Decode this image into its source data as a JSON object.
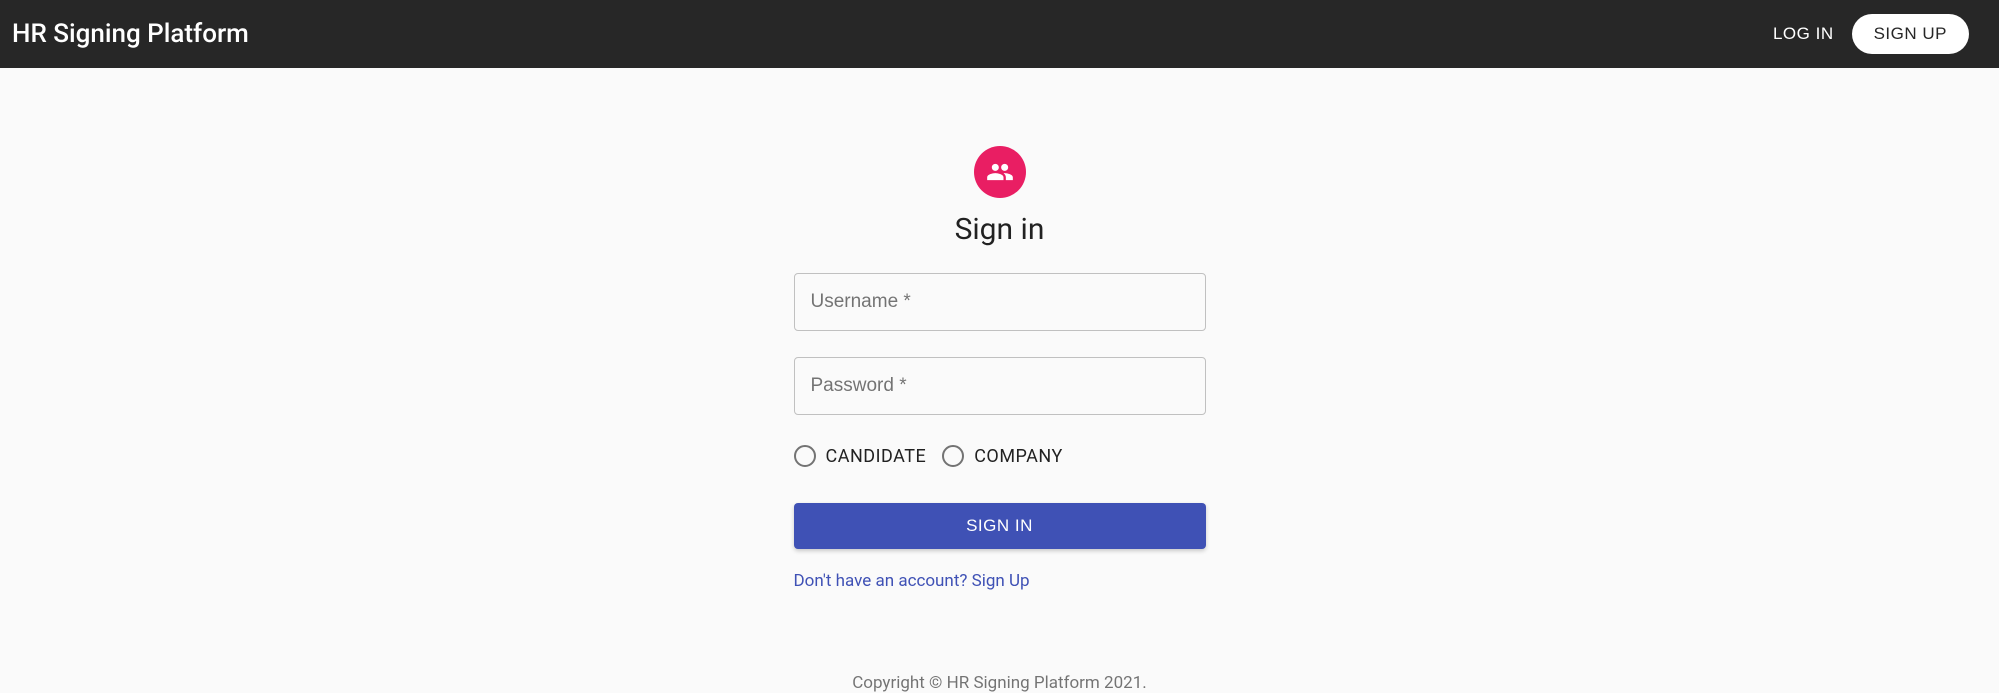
{
  "header": {
    "title": "HR Signing Platform",
    "login_label": "LOG IN",
    "signup_label": "SIGN UP"
  },
  "signin": {
    "title": "Sign in",
    "username_placeholder": "Username *",
    "password_placeholder": "Password *",
    "radio_candidate": "CANDIDATE",
    "radio_company": "COMPANY",
    "submit_label": "SIGN IN",
    "signup_link_text": "Don't have an account? Sign Up"
  },
  "footer": {
    "copyright": "Copyright © HR Signing Platform 2021."
  },
  "colors": {
    "header_bg": "#272727",
    "avatar_bg": "#e91e63",
    "primary": "#3f51b5"
  }
}
